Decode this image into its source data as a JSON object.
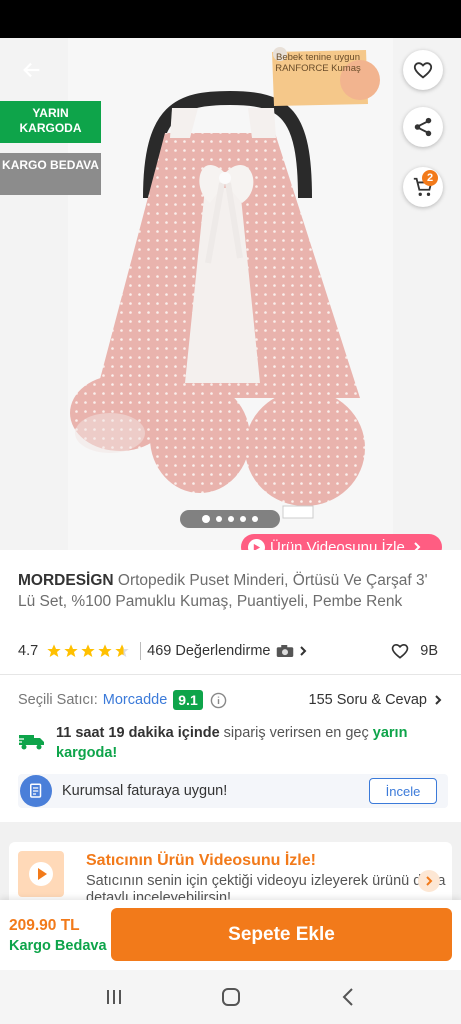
{
  "hero": {
    "badge_delivery": "YARIN KARGODA",
    "badge_shipping": "KARGO BEDAVA",
    "stamp_text": "Bebek tenine uygun RANFORCE Kumaş",
    "cart_count": "2",
    "video_button": "Ürün Videosunu İzle",
    "image_dots": 5,
    "active_dot": 0
  },
  "product": {
    "brand": "MORDESİGN",
    "name": "Ortopedik Puset Minderi, Örtüsü Ve Çarşaf 3' Lü Set, %100 Pamuklu Kumaş, Puantiyeli, Pembe Renk",
    "rating": "4.7",
    "rating_value": 4.7,
    "reviews": "469 Değerlendirme",
    "favorites": "9B"
  },
  "seller": {
    "label": "Seçili Satıcı:",
    "name": "Morcadde",
    "score": "9.1",
    "qa": "155 Soru & Cevap"
  },
  "delivery": {
    "time": "11 saat 19 dakika içinde",
    "middle": "sipariş verirsen en geç",
    "day": "yarın kargoda!"
  },
  "invoice": {
    "text": "Kurumsal faturaya uygun!",
    "button": "İncele"
  },
  "video_card": {
    "title": "Satıcının Ürün Videosunu İzle!",
    "desc": "Satıcının senin için çektiği videoyu izleyerek ürünü daha detaylı inceleyebilirsin!"
  },
  "bottom": {
    "price": "209.90 TL",
    "free_shipping": "Kargo Bedava",
    "add_to_cart": "Sepete Ekle"
  },
  "colors": {
    "accent": "#f27a1a",
    "green": "#0ea44a",
    "blue": "#3b7ad9",
    "pink": "#ff5d82"
  }
}
